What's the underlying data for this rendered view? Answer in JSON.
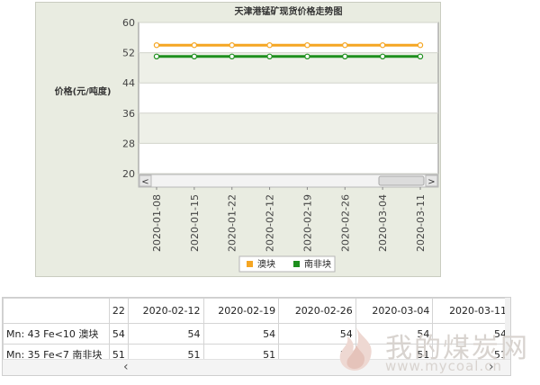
{
  "chart_data": {
    "type": "line",
    "title": "天津港锰矿现货价格走势图",
    "ylabel": "价格(元/吨度)",
    "xlabel": "",
    "ylim": [
      20,
      60
    ],
    "yticks": [
      20,
      28,
      36,
      44,
      52,
      60
    ],
    "categories": [
      "2020-01-08",
      "2020-01-15",
      "2020-01-22",
      "2020-02-12",
      "2020-02-19",
      "2020-02-26",
      "2020-03-04",
      "2020-03-11"
    ],
    "series": [
      {
        "name": "澳块",
        "color": "#f5a623",
        "values": [
          54,
          54,
          54,
          54,
          54,
          54,
          54,
          54
        ]
      },
      {
        "name": "南非块",
        "color": "#1e8f1e",
        "values": [
          51,
          51,
          51,
          51,
          51,
          51,
          51,
          51
        ]
      }
    ],
    "grid": true,
    "legend": "bottom",
    "scrollbar_left_arrow": "<",
    "scrollbar_right_arrow": ">"
  },
  "table": {
    "corner_header": "22",
    "columns": [
      "2020-02-12",
      "2020-02-19",
      "2020-02-26",
      "2020-03-04",
      "2020-03-11"
    ],
    "rows": [
      {
        "label": "Mn: 43 Fe<10 澳块",
        "prev": "54",
        "values": [
          "54",
          "54",
          "54",
          "54",
          "54"
        ]
      },
      {
        "label": "Mn: 35 Fe<7 南非块",
        "prev": "51",
        "values": [
          "51",
          "51",
          "51",
          "51",
          "51"
        ]
      }
    ],
    "scroll_left": "‹",
    "scroll_right": "›"
  },
  "watermark": {
    "text_cn": "我的煤炭网",
    "url": "www.mycoal.cn"
  }
}
